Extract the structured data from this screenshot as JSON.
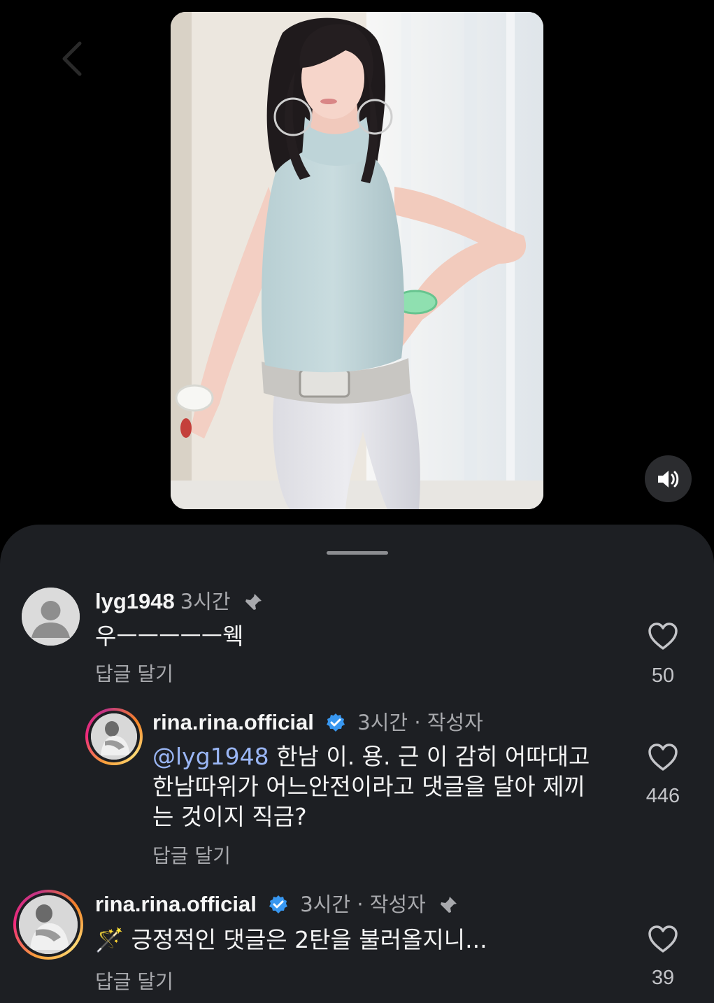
{
  "video": {
    "back_icon": "chevron-left-icon",
    "mute_icon": "speaker-icon"
  },
  "comments": [
    {
      "username": "lyg1948",
      "time": "3시간",
      "author_tag": "",
      "pinned": true,
      "verified": false,
      "text": "우ㅡㅡㅡㅡㅡ웩",
      "reply_label": "답글 달기",
      "likes": "50"
    },
    {
      "username": "rina.rina.official",
      "time": "3시간",
      "author_tag": "· 작성자",
      "pinned": false,
      "verified": true,
      "mention": "@lyg1948",
      "text_line1": " 한남 이. 용. 근 이 감히 어따대고",
      "text_line2": "한남따위가 어느안전이라고 댓글을 달아 제끼",
      "text_line3": "는 것이지 직금?",
      "reply_label": "답글 달기",
      "likes": "446"
    },
    {
      "username": "rina.rina.official",
      "time": "3시간",
      "author_tag": "· 작성자",
      "pinned": true,
      "verified": true,
      "emoji": "🪄",
      "text": "긍정적인 댓글은 2탄을 불러올지니...",
      "reply_label": "답글 달기",
      "likes": "39"
    }
  ],
  "colors": {
    "background": "#000000",
    "sheet": "#1d1f23",
    "mention": "#9ab6f5",
    "verified": "#3897f0",
    "muted_text": "#a8a9ad"
  }
}
